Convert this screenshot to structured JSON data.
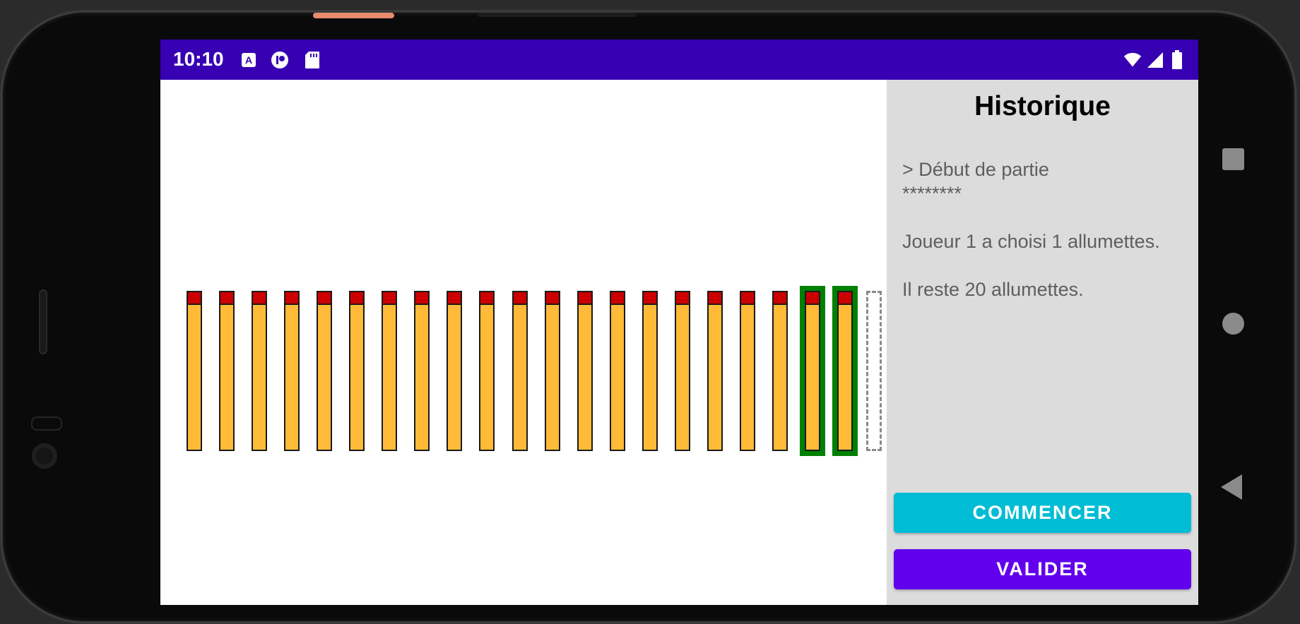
{
  "status_bar": {
    "time": "10:10",
    "icons": [
      "a-notification-icon",
      "app-notification-icon",
      "sd-card-icon",
      "wifi-icon",
      "signal-icon",
      "battery-icon"
    ]
  },
  "game": {
    "match_count": 21,
    "selected_matches": [
      19,
      20
    ],
    "empty_slots": 1,
    "colors": {
      "match_body": "#ffbb38",
      "match_head": "#cc0000",
      "selection": "#008000"
    }
  },
  "history": {
    "title": "Historique",
    "lines": [
      "> Début de partie",
      "********",
      "Joueur 1 a choisi 1 allumettes.",
      "Il reste 20 allumettes."
    ]
  },
  "buttons": {
    "start_label": "COMMENCER",
    "validate_label": "VALIDER"
  },
  "colors": {
    "status_bar": "#3700b3",
    "start_button": "#00bcd4",
    "validate_button": "#6200ee"
  }
}
